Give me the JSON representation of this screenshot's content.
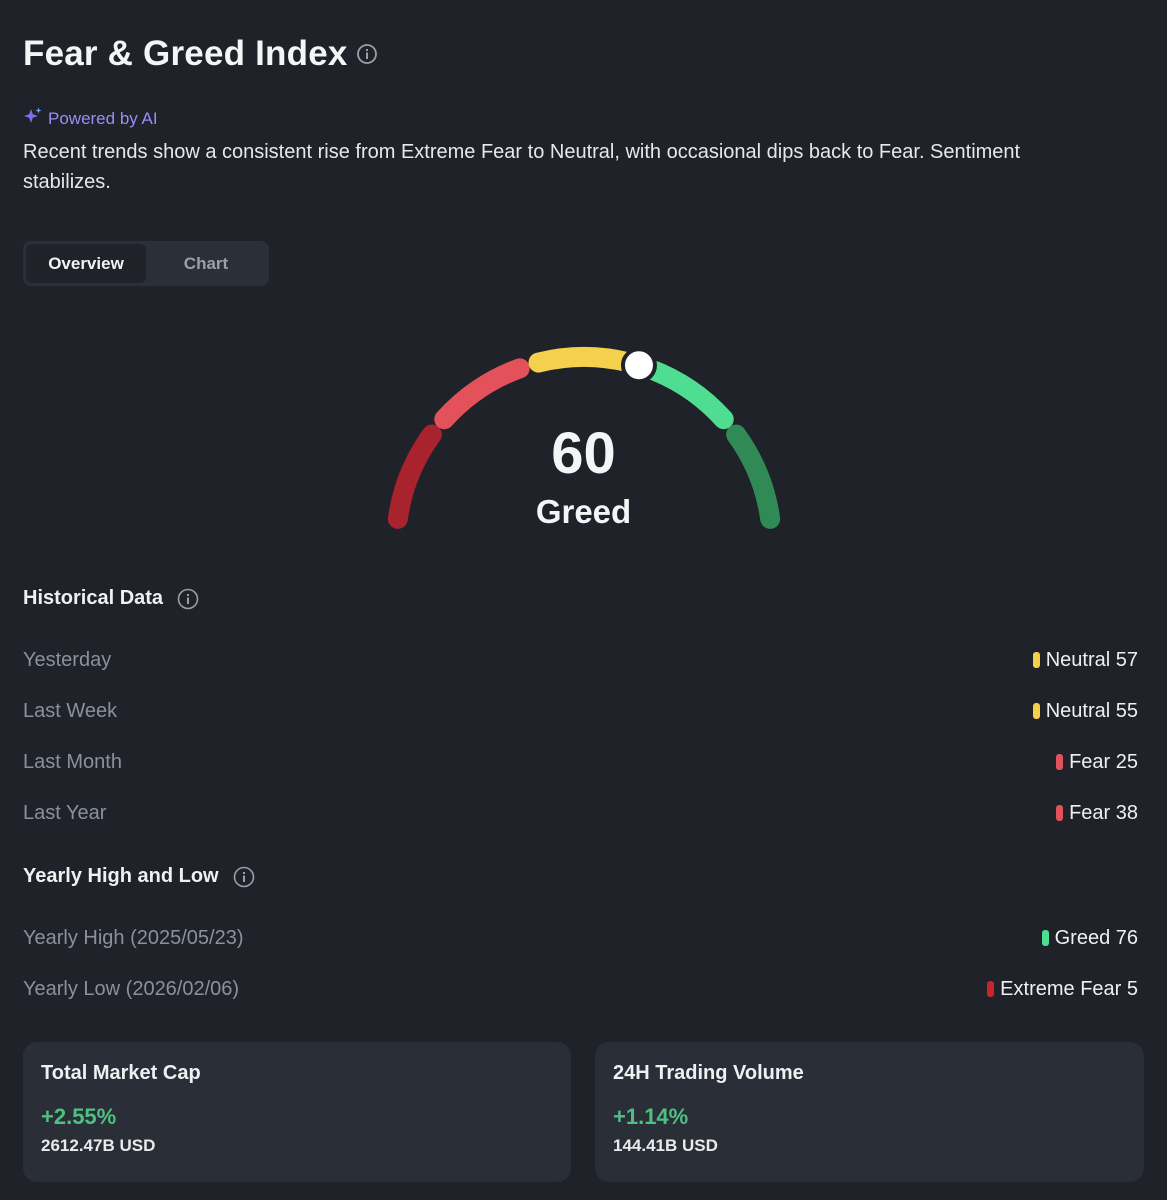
{
  "header": {
    "title": "Fear & Greed Index",
    "info_icon": "info-icon"
  },
  "ai": {
    "label": "Powered by AI",
    "icon": "sparkle-icon",
    "summary": "Recent trends show a consistent rise from Extreme Fear to Neutral, with occasional dips back to Fear. Sentiment stabilizes."
  },
  "tabs": [
    {
      "label": "Overview",
      "active": true
    },
    {
      "label": "Chart",
      "active": false
    }
  ],
  "gauge": {
    "value": "60",
    "label": "Greed",
    "score": 60,
    "min": 0,
    "max": 100,
    "segments": [
      {
        "name": "Extreme Fear",
        "color": "#a9232e"
      },
      {
        "name": "Fear",
        "color": "#e3525a"
      },
      {
        "name": "Neutral",
        "color": "#f5d04c"
      },
      {
        "name": "Greed",
        "color": "#4fdd92"
      },
      {
        "name": "Extreme Greed",
        "color": "#2f8a55"
      }
    ]
  },
  "historical": {
    "title": "Historical Data",
    "rows": [
      {
        "label": "Yesterday",
        "value": "Neutral 57",
        "color": "#f5d04c"
      },
      {
        "label": "Last Week",
        "value": "Neutral 55",
        "color": "#f5d04c"
      },
      {
        "label": "Last Month",
        "value": "Fear 25",
        "color": "#e3525a"
      },
      {
        "label": "Last Year",
        "value": "Fear 38",
        "color": "#e3525a"
      }
    ]
  },
  "yearly": {
    "title": "Yearly High and Low",
    "rows": [
      {
        "label": "Yearly High (2025/05/23)",
        "value": "Greed 76",
        "color": "#4fdd92"
      },
      {
        "label": "Yearly Low (2026/02/06)",
        "value": "Extreme Fear 5",
        "color": "#c8262f"
      }
    ]
  },
  "cards": [
    {
      "title": "Total Market Cap",
      "change": "+2.55%",
      "amount": "2612.47B USD"
    },
    {
      "title": "24H Trading Volume",
      "change": "+1.14%",
      "amount": "144.41B USD"
    }
  ],
  "colors": {
    "background": "#1f2228",
    "positive": "#4fc083",
    "accent_ai": "#9b8cf4"
  }
}
